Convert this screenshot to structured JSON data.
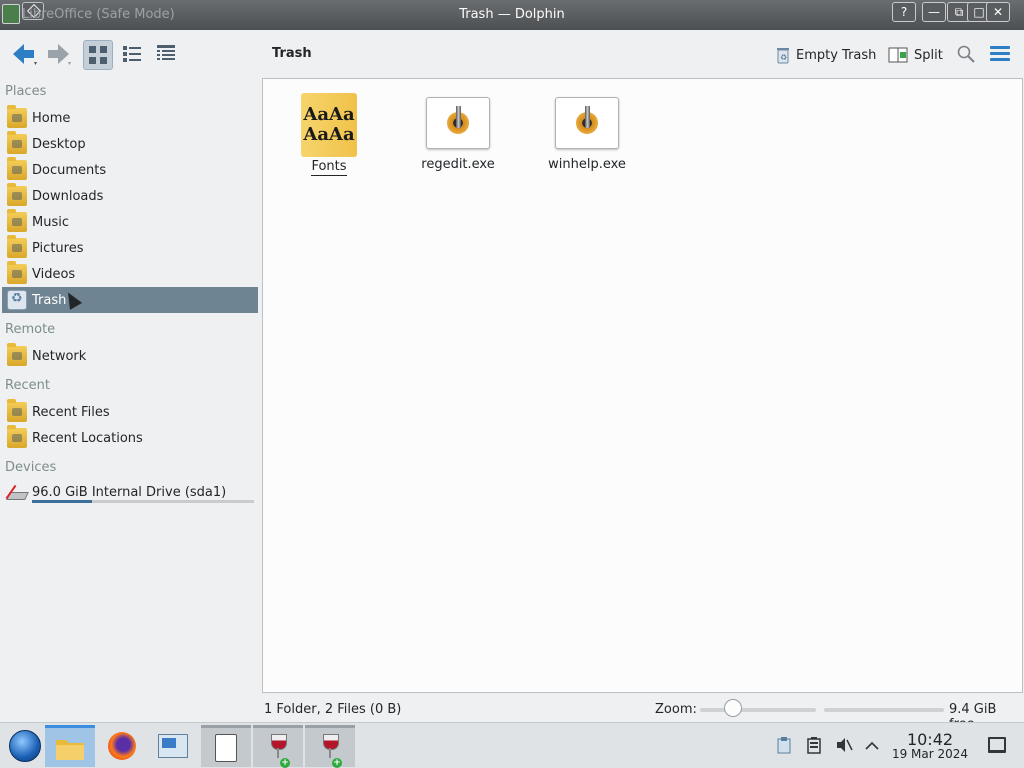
{
  "window": {
    "title": "Trash — Dolphin",
    "background_title": "LibreOffice (Safe Mode)",
    "buttons": {
      "help": "?",
      "minimize": "—",
      "maximize": "□",
      "close": "✕"
    }
  },
  "toolbar": {
    "back_icon": "arrow-left-icon",
    "forward_icon": "arrow-right-icon",
    "view_modes": [
      "icons",
      "compact",
      "details"
    ],
    "active_view": "icons",
    "breadcrumb": "Trash",
    "empty_trash_label": "Empty Trash",
    "split_label": "Split",
    "search_icon": "search-icon",
    "menu_icon": "hamburger-icon"
  },
  "sidebar": {
    "sections": {
      "places": "Places",
      "remote": "Remote",
      "recent": "Recent",
      "devices": "Devices"
    },
    "places": [
      {
        "label": "Home",
        "icon": "home-folder-icon"
      },
      {
        "label": "Desktop",
        "icon": "desktop-folder-icon"
      },
      {
        "label": "Documents",
        "icon": "documents-folder-icon"
      },
      {
        "label": "Downloads",
        "icon": "downloads-folder-icon"
      },
      {
        "label": "Music",
        "icon": "music-folder-icon"
      },
      {
        "label": "Pictures",
        "icon": "pictures-folder-icon"
      },
      {
        "label": "Videos",
        "icon": "videos-folder-icon"
      },
      {
        "label": "Trash",
        "icon": "trash-icon",
        "selected": true
      }
    ],
    "remote": [
      {
        "label": "Network",
        "icon": "network-folder-icon"
      }
    ],
    "recent": [
      {
        "label": "Recent Files",
        "icon": "recent-files-icon"
      },
      {
        "label": "Recent Locations",
        "icon": "recent-locations-icon"
      }
    ],
    "devices": [
      {
        "label": "96.0 GiB Internal Drive (sda1)",
        "icon": "drive-icon",
        "usage_fraction": 0.27
      }
    ]
  },
  "files": [
    {
      "name": "Fonts",
      "type": "folder",
      "icon": "fonts-folder-icon",
      "icon_text": "AaAa\nAaAa"
    },
    {
      "name": "regedit.exe",
      "type": "executable",
      "icon": "wine-executable-icon"
    },
    {
      "name": "winhelp.exe",
      "type": "executable",
      "icon": "wine-executable-icon"
    }
  ],
  "statusbar": {
    "summary": "1 Folder, 2 Files (0 B)",
    "zoom_label": "Zoom:",
    "zoom_level_fraction": 0.25,
    "free_space": "9.4 GiB free"
  },
  "taskbar": {
    "items": [
      {
        "name": "start-menu",
        "icon": "start-orb-icon"
      },
      {
        "name": "dolphin",
        "icon": "folder-icon",
        "state": "active"
      },
      {
        "name": "firefox",
        "icon": "firefox-icon"
      },
      {
        "name": "system-settings",
        "icon": "network-monitor-icon"
      },
      {
        "name": "libreoffice",
        "icon": "document-icon",
        "state": "running"
      },
      {
        "name": "wine-app-1",
        "icon": "wine-glass-icon",
        "state": "running"
      },
      {
        "name": "wine-app-2",
        "icon": "wine-glass-icon",
        "state": "running"
      }
    ],
    "tray_icons": [
      "clipboard-icon",
      "battery-icon",
      "speaker-muted-icon",
      "chevron-up-icon"
    ],
    "clock_time": "10:42",
    "clock_date": "19 Mar 2024"
  },
  "colors": {
    "accent": "#2e7ec6",
    "selected_place": "#6f8492",
    "window_bg": "#eff0f1",
    "view_bg": "#fcfcfc"
  }
}
